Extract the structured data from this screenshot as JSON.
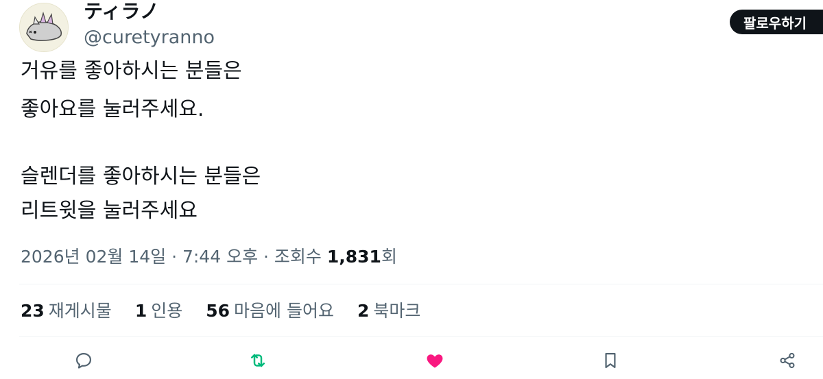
{
  "author": {
    "display_name": "ティラノ",
    "handle": "@curetyranno"
  },
  "follow_button_label": "팔로우하기",
  "tweet": {
    "lines": [
      "거유를 좋아하시는 분들은",
      "좋아요를 눌러주세요.",
      "슬렌더를 좋아하시는 분들은",
      "리트윗을 눌러주세요"
    ]
  },
  "meta": {
    "datetime": "2026년 02월 14일 · 7:44 오후 · 조회수 ",
    "views": "1,831",
    "views_suffix": "회"
  },
  "stats": {
    "retweets": {
      "count": "23",
      "label": "재게시물"
    },
    "quotes": {
      "count": "1",
      "label": "인용"
    },
    "likes": {
      "count": "56",
      "label": "마음에 들어요"
    },
    "bookmarks": {
      "count": "2",
      "label": "북마크"
    }
  },
  "actions": {
    "reply": "reply-icon",
    "retweet": "retweet-icon",
    "like": "heart-icon",
    "bookmark": "bookmark-icon",
    "share": "share-icon"
  },
  "colors": {
    "secondary_text": "#536471",
    "retweet_green": "#00ba7c",
    "like_pink": "#f91880",
    "follow_bg": "#0f1419"
  }
}
